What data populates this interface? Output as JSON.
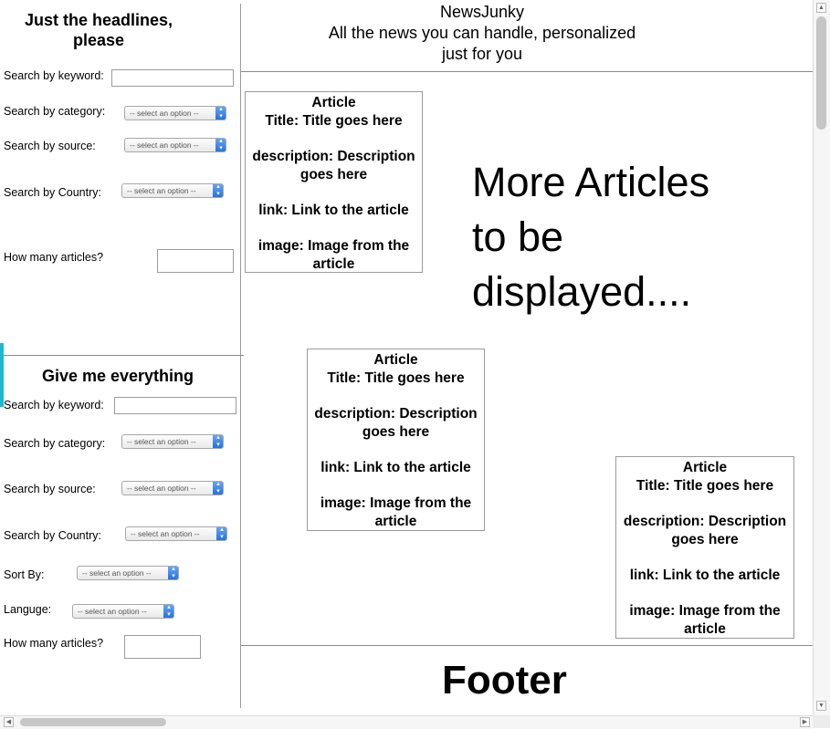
{
  "headlines_panel": {
    "title": "Just the headlines, please",
    "keyword_label": "Search by keyword:",
    "category_label": "Search by category:",
    "category_value": "-- select an option --",
    "source_label": "Search by source:",
    "source_value": "-- select an option --",
    "country_label": "Search by Country:",
    "country_value": "-- select an option --",
    "count_label": "How many articles?"
  },
  "everything_panel": {
    "title": "Give me everything",
    "keyword_label": "Search by keyword:",
    "category_label": "Search by category:",
    "category_value": "-- select an option --",
    "source_label": "Search by source:",
    "source_value": "-- select an option --",
    "country_label": "Search by Country:",
    "country_value": "-- select an option --",
    "sort_label": "Sort By:",
    "sort_value": "-- select an option --",
    "language_label": "Languge:",
    "language_value": "-- select an option --",
    "count_label": "How many articles?"
  },
  "header": {
    "app_name": "NewsJunky",
    "tagline_line1": "All the news you can handle, personalized",
    "tagline_line2": "just for you"
  },
  "articles": [
    {
      "heading": "Article",
      "title": "Title: Title goes here",
      "description": "description: Description goes here",
      "link": "link: Link to the article",
      "image": "image: Image from the article"
    },
    {
      "heading": "Article",
      "title": "Title: Title goes here",
      "description": "description: Description goes here",
      "link": "link: Link to the article",
      "image": "image: Image from the article"
    },
    {
      "heading": "Article",
      "title": "Title: Title goes here",
      "description": "description: Description goes here",
      "link": "link: Link to the article",
      "image": "image: Image from the article"
    }
  ],
  "more_articles": {
    "line1": "More Articles",
    "line2": "to be",
    "line3": "displayed...."
  },
  "footer": {
    "text": "Footer"
  },
  "icons": {
    "select_arrows": "up-down-chevron-icon",
    "scroll_up": "arrow-up-icon",
    "scroll_down": "arrow-down-icon",
    "scroll_left": "arrow-left-icon",
    "scroll_right": "arrow-right-icon"
  },
  "colors": {
    "select_accent": "#1e6fe0",
    "edge_tab": "#1cb8d0"
  }
}
